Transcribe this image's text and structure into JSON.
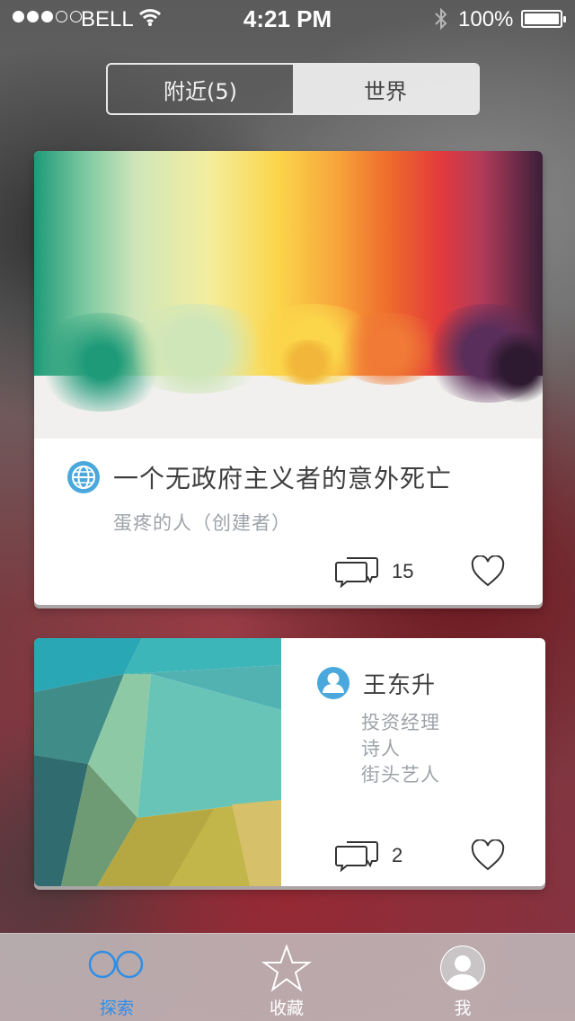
{
  "status_bar": {
    "carrier": "BELL",
    "time": "4:21 PM",
    "battery": "100%",
    "battery_level": 1.0,
    "signal_bars_filled": 3,
    "signal_bars_total": 5
  },
  "segment": {
    "items": [
      {
        "label": "附近(5)",
        "active": true
      },
      {
        "label": "世界",
        "active": false
      }
    ]
  },
  "cards": [
    {
      "type": "topic",
      "icon": "globe-icon",
      "title": "一个无政府主义者的意外死亡",
      "subtitle": "蛋疼的人（创建者）",
      "comment_count": "15",
      "liked": false
    },
    {
      "type": "person",
      "icon": "person-icon",
      "name": "王东升",
      "tags": [
        "投资经理",
        "诗人",
        "街头艺人"
      ],
      "comment_count": "2",
      "liked": false
    }
  ],
  "tabbar": {
    "items": [
      {
        "label": "探索",
        "icon": "explore-icon",
        "active": true
      },
      {
        "label": "收藏",
        "icon": "star-icon",
        "active": false
      },
      {
        "label": "我",
        "icon": "avatar-icon",
        "active": false
      }
    ]
  },
  "colors": {
    "accent": "#2f8ee6",
    "icon_blue": "#4aa8dd",
    "text_dark": "#3f3f3f",
    "text_muted": "#9ea3a9"
  }
}
